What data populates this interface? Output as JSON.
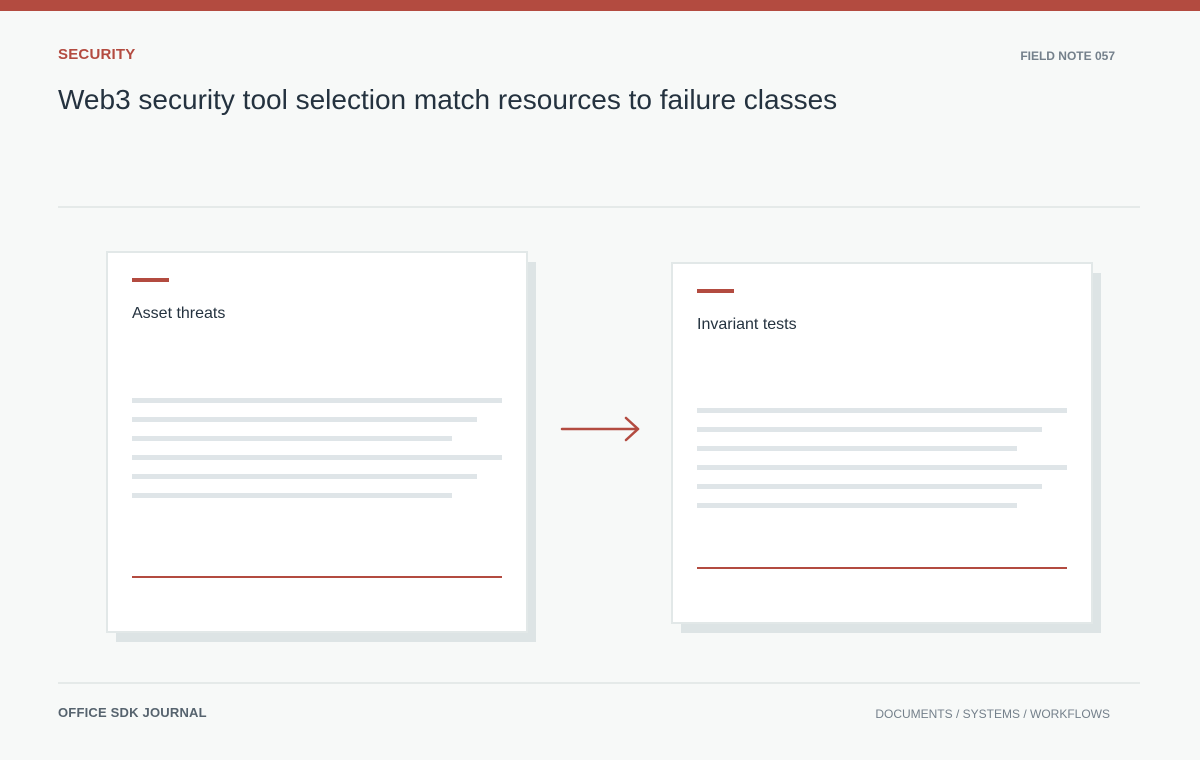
{
  "header": {
    "kicker": "SECURITY",
    "note_label": "FIELD NOTE 057",
    "title": "Web3 security tool selection match resources to failure classes"
  },
  "cards": [
    {
      "title": "Asset threats"
    },
    {
      "title": "Invariant tests"
    }
  ],
  "footer": {
    "journal": "OFFICE SDK JOURNAL",
    "breadcrumb": "DOCUMENTS / SYSTEMS / WORKFLOWS"
  },
  "colors": {
    "accent": "#b34b40",
    "text": "#24323f",
    "muted": "#74808b",
    "placeholder_line": "#dfe5e8",
    "background": "#f7f9f8"
  },
  "icons": {
    "flow_arrow": "right-arrow-icon"
  }
}
